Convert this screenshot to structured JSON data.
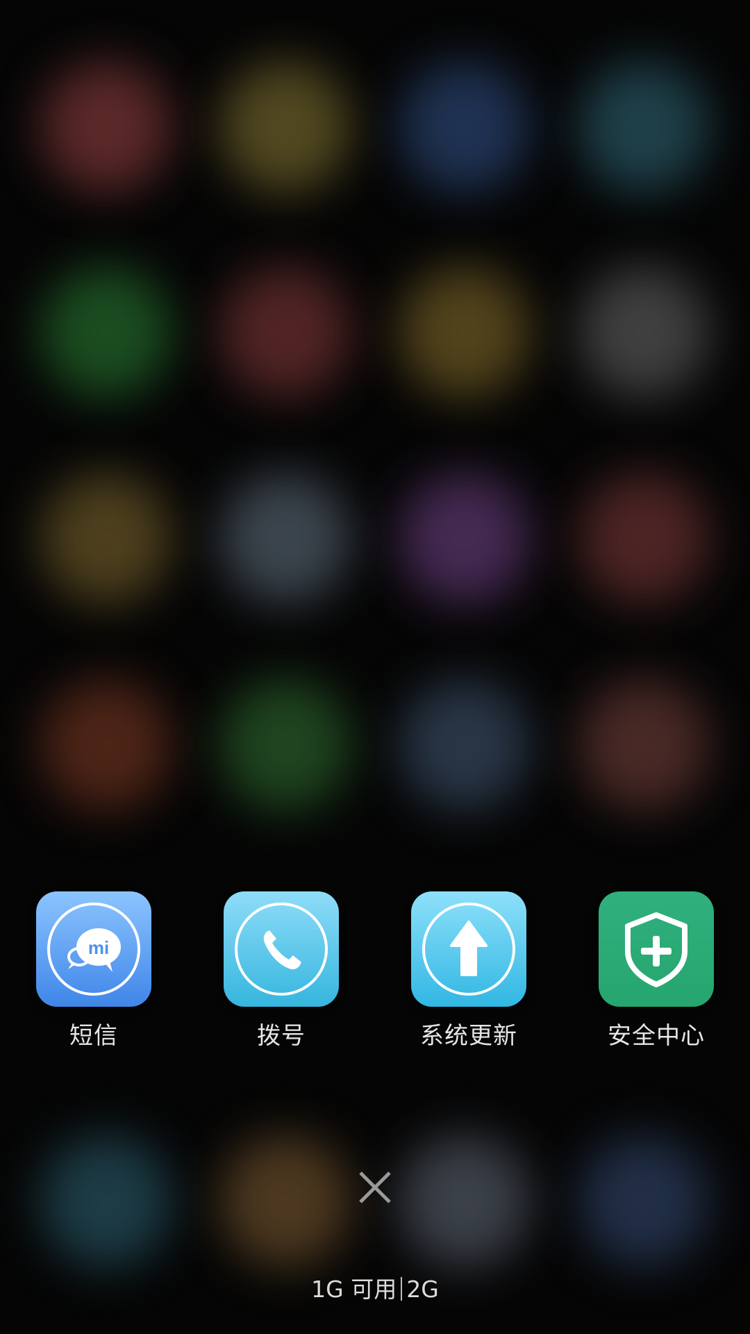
{
  "recent_apps": [
    {
      "label": "短信",
      "icon": "mi-message-icon",
      "color_top": "#8cc4ff",
      "color_bottom": "#3f86e8"
    },
    {
      "label": "拨号",
      "icon": "phone-icon",
      "color_top": "#8fdcf8",
      "color_bottom": "#35b6de"
    },
    {
      "label": "系统更新",
      "icon": "upload-arrow-icon",
      "color_top": "#8ee0fa",
      "color_bottom": "#31b7e3"
    },
    {
      "label": "安全中心",
      "icon": "shield-plus-icon",
      "color_top": "#2fb07d",
      "color_bottom": "#27a56f"
    }
  ],
  "memory_status": {
    "available": "1G 可用",
    "total": "2G"
  },
  "close_button": {
    "icon": "close-icon"
  },
  "background_blur_colors": [
    "#6a2f2f",
    "#5f5425",
    "#243a60",
    "#234a55",
    "#1f5a25",
    "#5f2a2a",
    "#5f4e1f",
    "#4a4a4a",
    "#5a4a22",
    "#45505a",
    "#503060",
    "#5a2a2a",
    "#5a2a1a",
    "#245024",
    "#2f3f52",
    "#55302c",
    "#214652",
    "#5a4225",
    "#454b55",
    "#263652"
  ]
}
